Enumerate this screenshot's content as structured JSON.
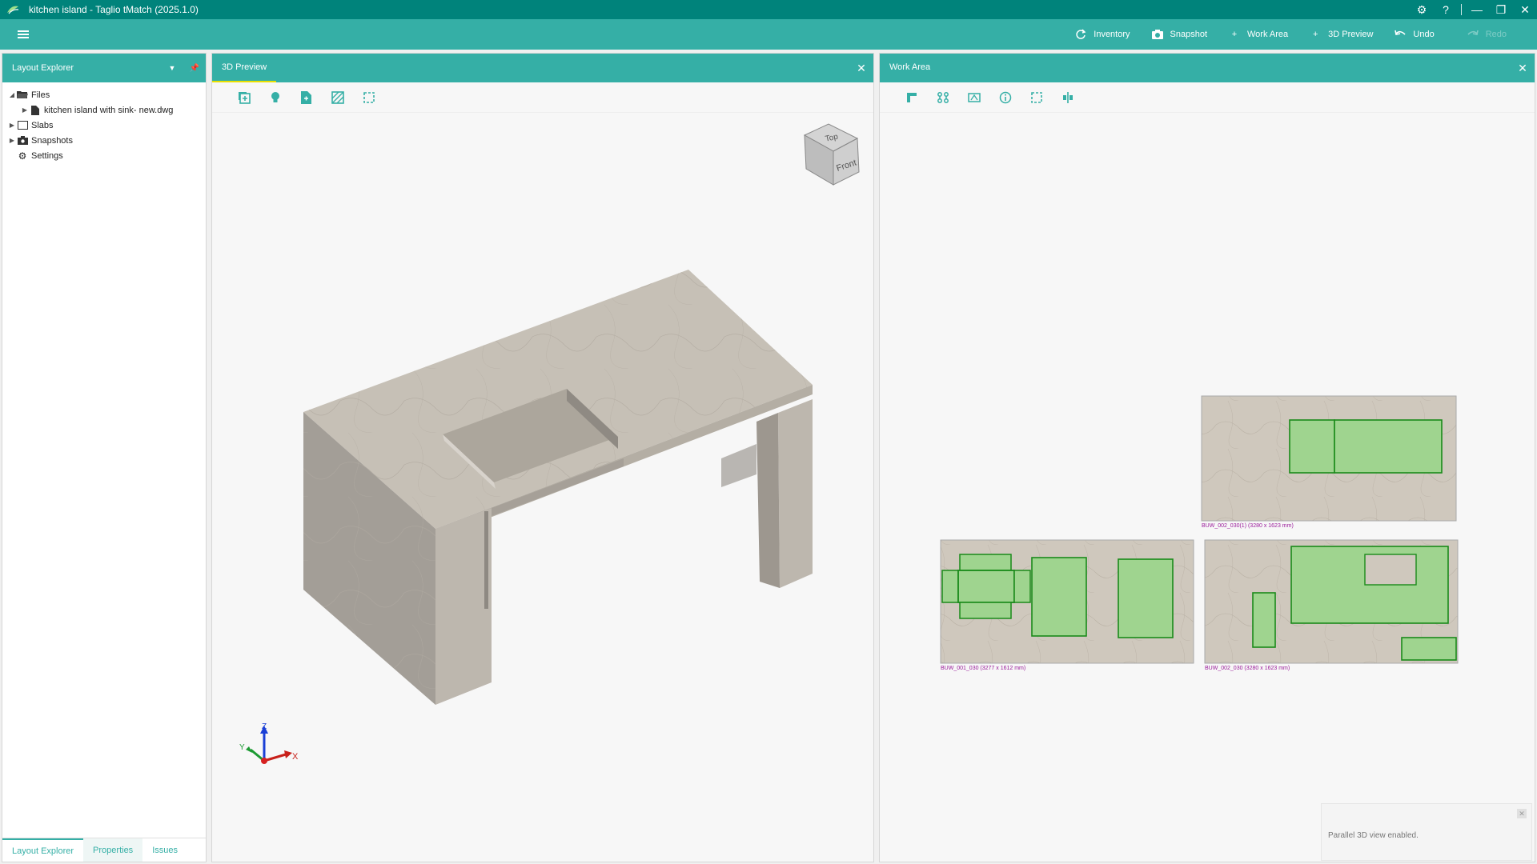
{
  "window": {
    "title": "kitchen island - Taglio tMatch (2025.1.0)"
  },
  "ribbon": {
    "inventory": "Inventory",
    "snapshot": "Snapshot",
    "work_area": "Work Area",
    "preview_3d": "3D Preview",
    "undo": "Undo",
    "redo": "Redo"
  },
  "explorer": {
    "title": "Layout Explorer",
    "files": "Files",
    "file_name": "kitchen island with sink- new.dwg",
    "slabs": "Slabs",
    "snapshots": "Snapshots",
    "settings": "Settings",
    "tabs": [
      "Layout Explorer",
      "Properties",
      "Issues"
    ]
  },
  "preview": {
    "tab": "3D Preview",
    "cube_top": "Top",
    "cube_front": "Front",
    "axis_x": "X",
    "axis_y": "Y",
    "axis_z": "Z"
  },
  "workarea": {
    "tab": "Work Area",
    "slabs": [
      {
        "label": "BUW_002_030(1) (3280 x 1623 mm)"
      },
      {
        "label": "BUW_001_030 (3277 x 1612 mm)"
      },
      {
        "label": "BUW_002_030 (3280 x 1623 mm)"
      }
    ]
  },
  "toast": {
    "message": "Parallel 3D view enabled."
  },
  "colors": {
    "titlebar": "#00837b",
    "ribbon": "#35afa6",
    "accent_yellow": "#e9e000",
    "piece_fill": "#9fd48f",
    "piece_stroke": "#1a8a1a",
    "label_magenta": "#9a1a9a"
  }
}
